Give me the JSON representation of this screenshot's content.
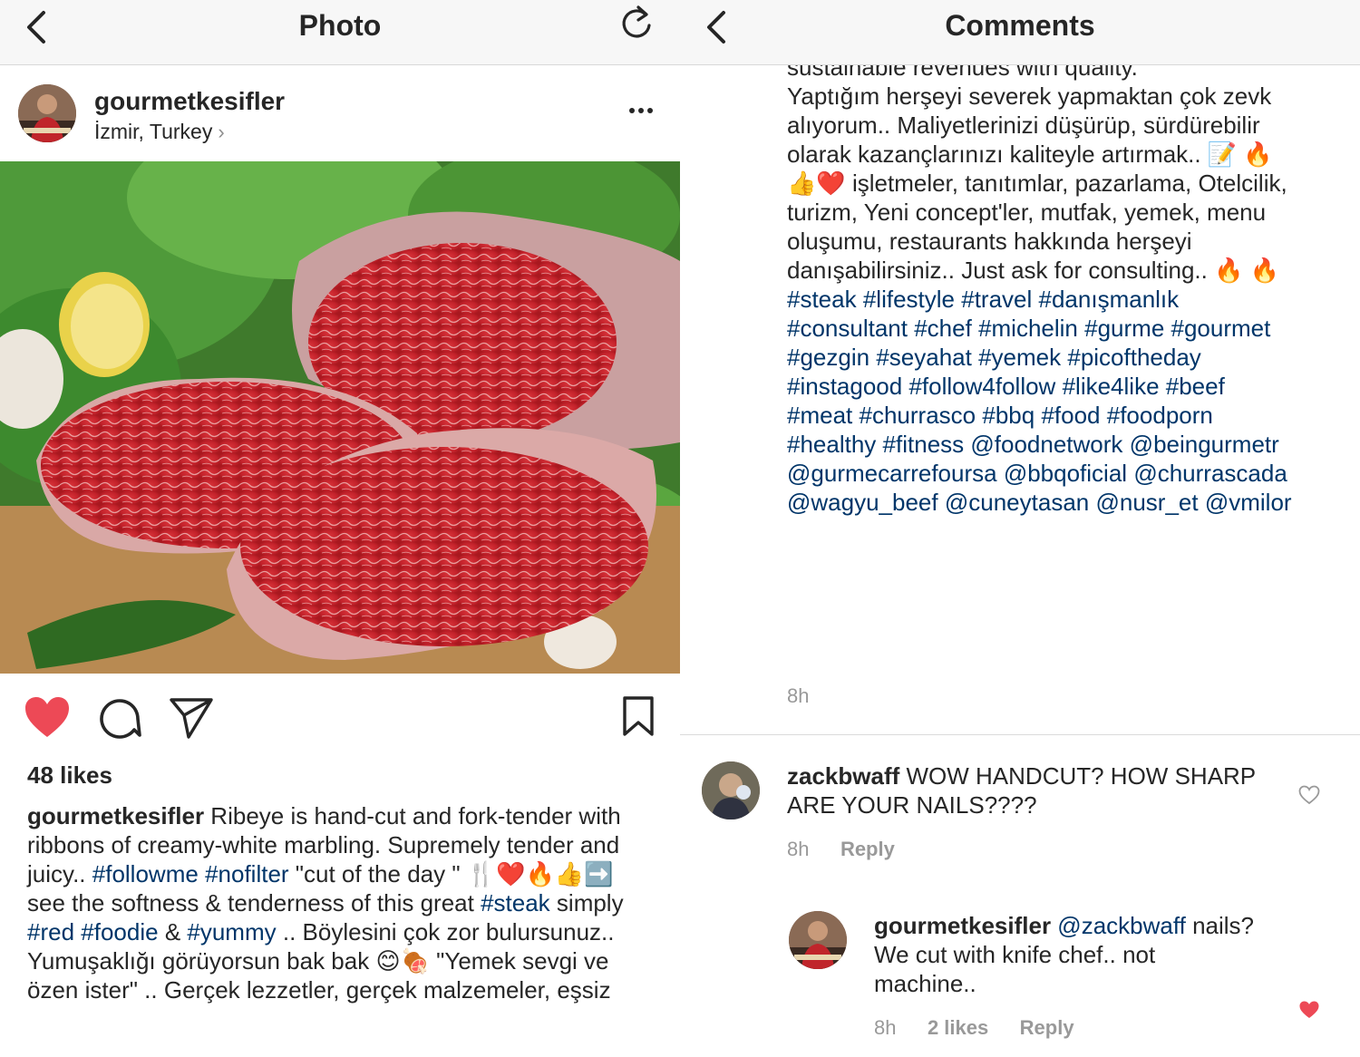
{
  "left": {
    "nav_title": "Photo",
    "post": {
      "username": "gourmetkesifler",
      "location": "İzmir, Turkey",
      "location_chevron": "›",
      "likes": "48 likes",
      "caption_user": "gourmetkesifler",
      "caption_parts": [
        {
          "t": " Ribeye is hand-cut and fork-tender with ribbons of creamy-white marbling. Supremely tender and juicy.. "
        },
        {
          "tag": "#followme"
        },
        {
          "t": " "
        },
        {
          "tag": "#nofilter"
        },
        {
          "t": " \"cut of the day \" 🍴❤️🔥👍➡️ see the softness & tenderness of this great "
        },
        {
          "tag": "#steak"
        },
        {
          "t": " simply "
        },
        {
          "tag": "#red"
        },
        {
          "t": " "
        },
        {
          "tag": "#foodie"
        },
        {
          "t": " & "
        },
        {
          "tag": "#yummy"
        },
        {
          "t": " .. Böylesini çok zor bulursunuz.. Yumuşaklığı görüyorsun bak bak 😊🍖 \"Yemek sevgi ve özen ister\" .. Gerçek lezzetler, gerçek malzemeler, eşsiz"
        }
      ]
    },
    "icons": {
      "back": "chevron-left-icon",
      "refresh": "refresh-icon",
      "more": "more-dots-icon",
      "like": "heart-filled-icon",
      "comment": "comment-bubble-icon",
      "share": "paper-plane-icon",
      "save": "bookmark-icon"
    },
    "colors": {
      "like_red": "#ed4956",
      "hashtag": "#003569"
    }
  },
  "right": {
    "nav_title": "Comments",
    "description": {
      "top_cut": "sustainable revenues with quality.",
      "body_parts": [
        {
          "t": "Yaptığım herşeyi severek yapmaktan çok zevk alıyorum.. Maliyetlerinizi düşürüp, sürdürebilir olarak kazançlarınızı kaliteyle artırmak.. 📝 🔥👍❤️ işletmeler, tanıtımlar, pazarlama, Otelcilik, turizm, Yeni concept'ler, mutfak, yemek, menu oluşumu, restaurants hakkında herşeyi danışabilirsiniz.. Just ask for consulting.. 🔥 🔥  "
        },
        {
          "tag": "#steak"
        },
        {
          "t": " "
        },
        {
          "tag": "#lifestyle"
        },
        {
          "t": " "
        },
        {
          "tag": "#travel"
        },
        {
          "t": " "
        },
        {
          "tag": "#danışmanlık"
        },
        {
          "t": " "
        },
        {
          "tag": "#consultant"
        },
        {
          "t": " "
        },
        {
          "tag": "#chef"
        },
        {
          "t": " "
        },
        {
          "tag": "#michelin"
        },
        {
          "t": " "
        },
        {
          "tag": "#gurme"
        },
        {
          "t": " "
        },
        {
          "tag": "#gourmet"
        },
        {
          "t": " "
        },
        {
          "tag": "#gezgin"
        },
        {
          "t": " "
        },
        {
          "tag": "#seyahat"
        },
        {
          "t": " "
        },
        {
          "tag": "#yemek"
        },
        {
          "t": " "
        },
        {
          "tag": "#picoftheday"
        },
        {
          "t": " "
        },
        {
          "tag": "#instagood"
        },
        {
          "t": " "
        },
        {
          "tag": "#follow4follow"
        },
        {
          "t": " "
        },
        {
          "tag": "#like4like"
        },
        {
          "t": " "
        },
        {
          "tag": "#beef"
        },
        {
          "t": " "
        },
        {
          "tag": "#meat"
        },
        {
          "t": " "
        },
        {
          "tag": "#churrasco"
        },
        {
          "t": " "
        },
        {
          "tag": "#bbq"
        },
        {
          "t": " "
        },
        {
          "tag": "#food"
        },
        {
          "t": " "
        },
        {
          "tag": "#foodporn"
        },
        {
          "t": "  "
        },
        {
          "tag": "#healthy"
        },
        {
          "t": " "
        },
        {
          "tag": "#fitness"
        },
        {
          "t": " "
        },
        {
          "tag": "@foodnetwork"
        },
        {
          "t": " "
        },
        {
          "tag": "@beingurmetr"
        },
        {
          "t": " "
        },
        {
          "tag": "@gurmecarrefoursa"
        },
        {
          "t": " "
        },
        {
          "tag": "@bbqoficial"
        },
        {
          "t": " "
        },
        {
          "tag": "@churrascada"
        },
        {
          "t": " "
        },
        {
          "tag": "@wagyu_beef"
        },
        {
          "t": " "
        },
        {
          "tag": "@cuneytasan"
        },
        {
          "t": " "
        },
        {
          "tag": "@nusr_et"
        },
        {
          "t": " "
        },
        {
          "tag": "@vmilor"
        }
      ],
      "time": "8h"
    },
    "comments": [
      {
        "user": "zackbwaff",
        "text": " WOW HANDCUT? HOW SHARP ARE YOUR NAILS????",
        "time": "8h",
        "reply": "Reply",
        "liked": false
      },
      {
        "user": "gourmetkesifler",
        "mention": " @zackbwaff",
        "text": " nails? We cut with knife chef.. not machine..",
        "time": "8h",
        "likes": "2 likes",
        "reply": "Reply",
        "liked": true
      }
    ]
  }
}
